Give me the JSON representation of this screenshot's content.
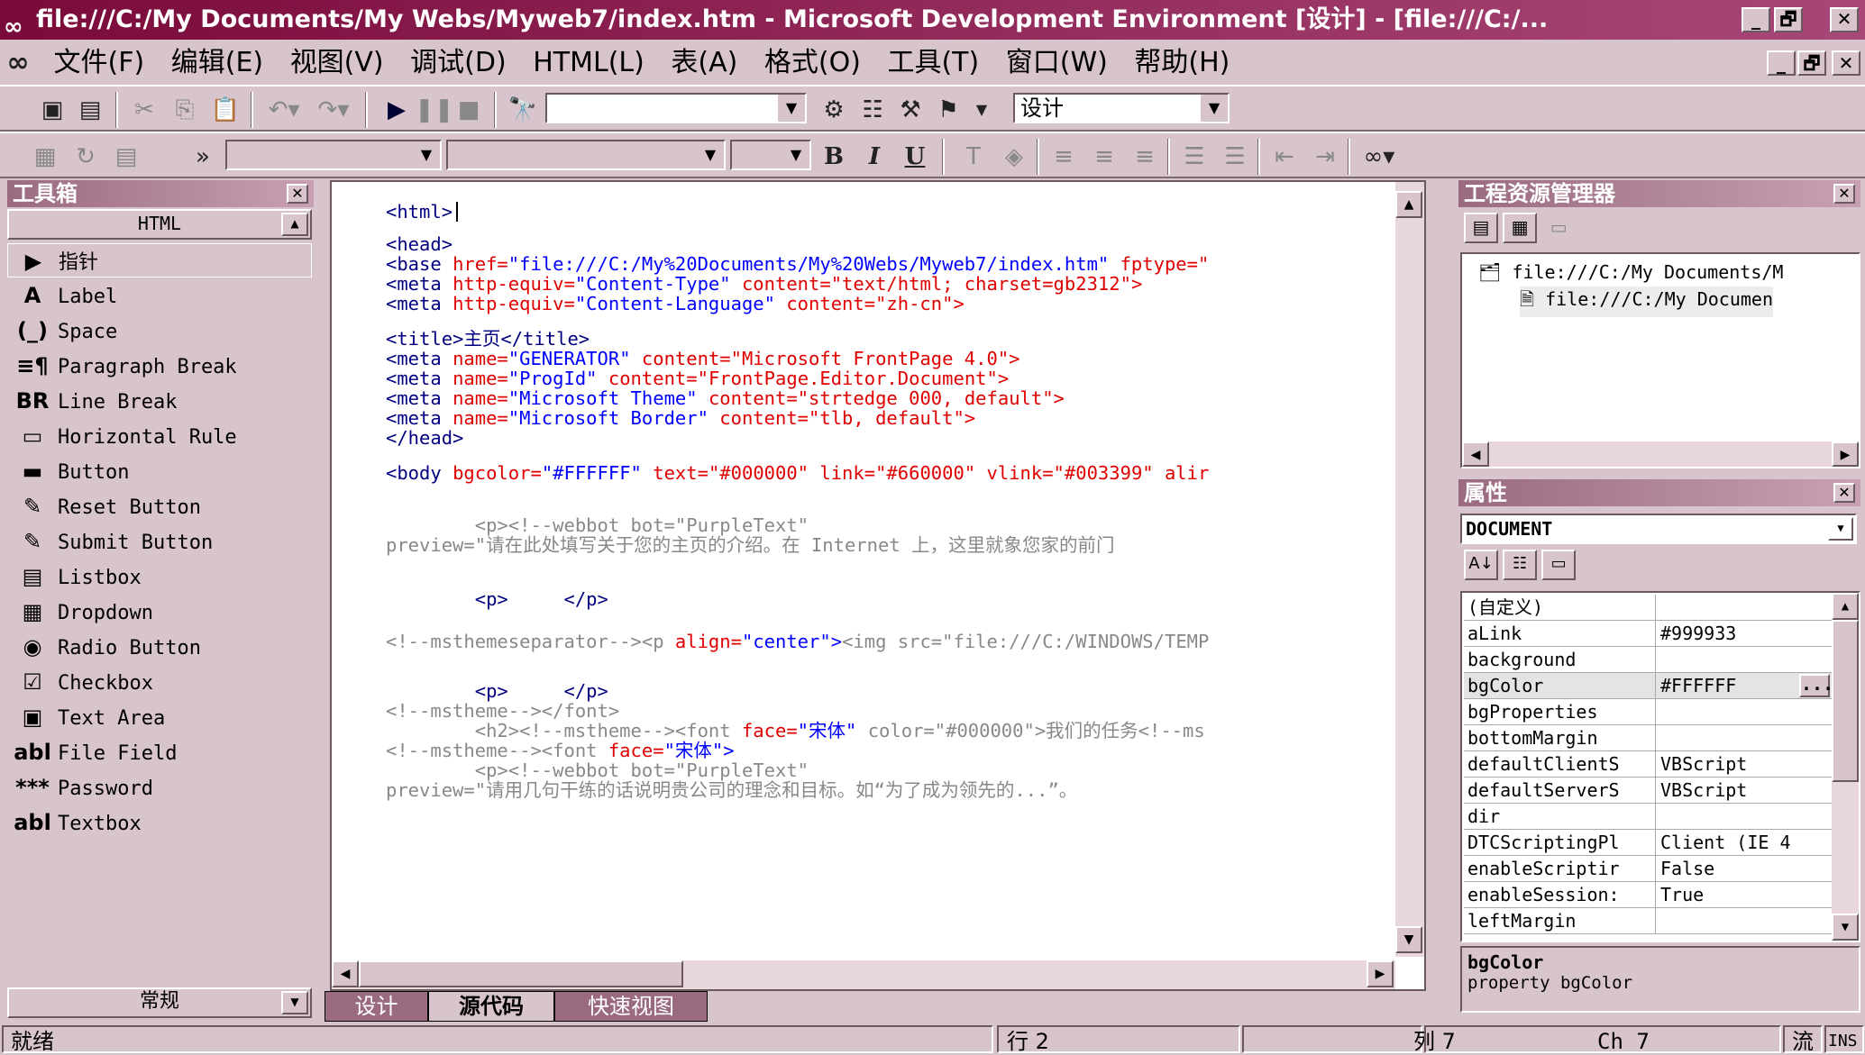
{
  "window": {
    "title": "file:///C:/My Documents/My Webs/Myweb7/index.htm - Microsoft Development Environment [设计] - [file:///C:/...",
    "min": "_",
    "max": "🗗",
    "close": "✕"
  },
  "menu": {
    "items": [
      "文件(F)",
      "编辑(E)",
      "视图(V)",
      "调试(D)",
      "HTML(L)",
      "表(A)",
      "格式(O)",
      "工具(T)",
      "窗口(W)",
      "帮助(H)"
    ],
    "mdi_min": "_",
    "mdi_max": "🗗",
    "mdi_close": "✕"
  },
  "toolbar1": {
    "mode_combo": "设计",
    "find_combo": ""
  },
  "toolbar2": {
    "bold": "B",
    "italic": "I",
    "underline": "U"
  },
  "toolbox": {
    "title": "工具箱",
    "tab": "HTML",
    "footer_tab": "常规",
    "items": [
      {
        "icon": "▶",
        "label": "指针"
      },
      {
        "icon": "A",
        "label": "Label"
      },
      {
        "icon": "(_)",
        "label": "Space"
      },
      {
        "icon": "≡¶",
        "label": "Paragraph Break"
      },
      {
        "icon": "BR",
        "label": "Line Break"
      },
      {
        "icon": "▭",
        "label": "Horizontal Rule"
      },
      {
        "icon": "▬",
        "label": "Button"
      },
      {
        "icon": "✎",
        "label": "Reset Button"
      },
      {
        "icon": "✎",
        "label": "Submit Button"
      },
      {
        "icon": "▤",
        "label": "Listbox"
      },
      {
        "icon": "▦",
        "label": "Dropdown"
      },
      {
        "icon": "◉",
        "label": "Radio Button"
      },
      {
        "icon": "☑",
        "label": "Checkbox"
      },
      {
        "icon": "▣",
        "label": "Text Area"
      },
      {
        "icon": "abl",
        "label": "File Field"
      },
      {
        "icon": "***",
        "label": "Password"
      },
      {
        "icon": "abl",
        "label": "Textbox"
      }
    ]
  },
  "editor": {
    "lines": [
      {
        "t": "<html>",
        "a": "",
        "v": "",
        "k": ""
      },
      {
        "t": "<head>",
        "a": "",
        "v": "",
        "k": ""
      },
      {
        "t": "<base ",
        "a": "href=",
        "v": "\"file:///C:/My%20Documents/My%20Webs/Myweb7/index.htm\" ",
        "k": "fptype=\""
      },
      {
        "t": "<meta ",
        "a": "http-equiv=",
        "v": "\"Content-Type\" ",
        "k": "content=\"text/html; charset=gb2312\">"
      },
      {
        "t": "<meta ",
        "a": "http-equiv=",
        "v": "\"Content-Language\" ",
        "k": "content=\"zh-cn\">"
      },
      {
        "t": "<title>主页</title>",
        "a": "",
        "v": "",
        "k": ""
      },
      {
        "t": "<meta ",
        "a": "name=",
        "v": "\"GENERATOR\" ",
        "k": "content=\"Microsoft FrontPage 4.0\">"
      },
      {
        "t": "<meta ",
        "a": "name=",
        "v": "\"ProgId\" ",
        "k": "content=\"FrontPage.Editor.Document\">"
      },
      {
        "t": "<meta ",
        "a": "name=",
        "v": "\"Microsoft Theme\" ",
        "k": "content=\"strtedge 000, default\">"
      },
      {
        "t": "<meta ",
        "a": "name=",
        "v": "\"Microsoft Border\" ",
        "k": "content=\"tlb, default\">"
      },
      {
        "t": "</head>",
        "a": "",
        "v": "",
        "k": ""
      },
      {
        "t": "<body ",
        "a": "bgcolor=",
        "v": "\"#FFFFFF\" ",
        "k": "text=\"#000000\" link=\"#660000\" vlink=\"#003399\" alir"
      },
      {
        "t": "        <p><!--",
        "a": "",
        "v": "",
        "k": "webbot bot=\"PurpleText\""
      },
      {
        "t": "preview=\"请在此处填写关于您的主页的介绍。在 Internet 上，这里就象您家的前门",
        "a": "",
        "v": "",
        "k": ""
      },
      {
        "t": "        <p>     </p>",
        "a": "",
        "v": "",
        "k": ""
      },
      {
        "t": "<!--msthemeseparator--><p ",
        "a": "align=",
        "v": "\"center\">",
        "k": "<img src=\"file:///C:/WINDOWS/TEMP"
      },
      {
        "t": "        <p>     </p>",
        "a": "",
        "v": "",
        "k": ""
      },
      {
        "t": "<!--mstheme--></font>",
        "a": "",
        "v": "",
        "k": ""
      },
      {
        "t": "        <h2><!--mstheme--><font ",
        "a": "face=",
        "v": "\"宋体\" ",
        "k": "color=\"#000000\">我们的任务<!--ms"
      },
      {
        "t": "<!--mstheme--><font ",
        "a": "face=",
        "v": "\"宋体\">",
        "k": ""
      },
      {
        "t": "        <p><!--",
        "a": "",
        "v": "",
        "k": "webbot bot=\"PurpleText\""
      },
      {
        "t": "preview=\"请用几句干练的话说明贵公司的理念和目标。如“为了成为领先的...”。",
        "a": "",
        "v": "",
        "k": ""
      }
    ]
  },
  "tabs": [
    "设计",
    "源代码",
    "快速视图"
  ],
  "explorer": {
    "title": "工程资源管理器",
    "nodes": [
      "file:///C:/My Documents/M",
      "file:///C:/My Documen"
    ]
  },
  "properties": {
    "title": "属性",
    "object": "DOCUMENT",
    "rows": [
      {
        "name": "(自定义)",
        "value": ""
      },
      {
        "name": "aLink",
        "value": "#999933"
      },
      {
        "name": "background",
        "value": ""
      },
      {
        "name": "bgColor",
        "value": "#FFFFFF"
      },
      {
        "name": "bgProperties",
        "value": ""
      },
      {
        "name": "bottomMargin",
        "value": ""
      },
      {
        "name": "defaultClientS",
        "value": "VBScript"
      },
      {
        "name": "defaultServerS",
        "value": "VBScript"
      },
      {
        "name": "dir",
        "value": ""
      },
      {
        "name": "DTCScriptingPl",
        "value": "Client (IE 4"
      },
      {
        "name": "enableScriptir",
        "value": "False"
      },
      {
        "name": "enableSession:",
        "value": "True"
      },
      {
        "name": "leftMargin",
        "value": ""
      }
    ],
    "desc_title": "bgColor",
    "desc_text": "property bgColor",
    "ellipsis": "..."
  },
  "status": {
    "ready": "就绪",
    "line": "行 2",
    "col": "列 7",
    "ch": "Ch 7",
    "flow": "流",
    "ins": "INS"
  },
  "colors": {
    "title_from": "#7a0a3a",
    "title_to": "#a84878",
    "face": "#d8c4cc",
    "tag": "#000080",
    "attr": "#e00000",
    "value": "#0000ff",
    "comment": "#888888"
  }
}
